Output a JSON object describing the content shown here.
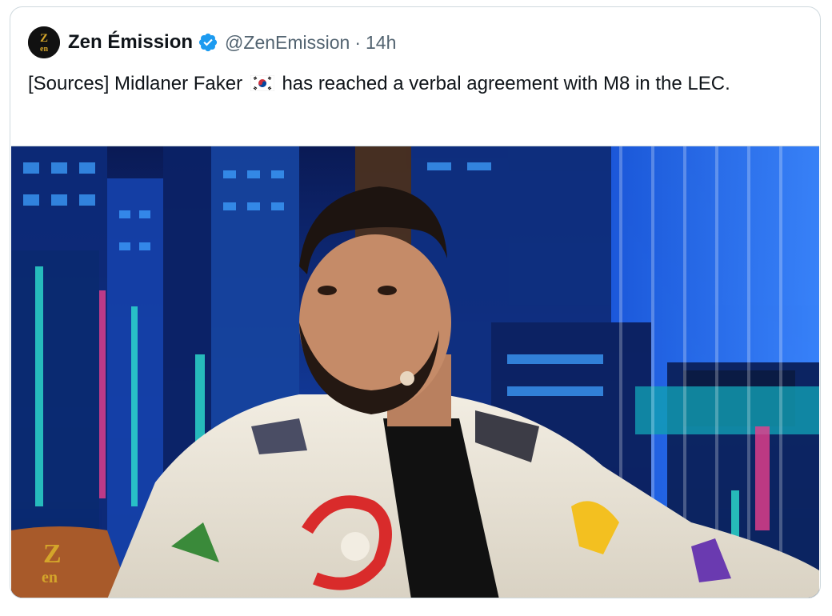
{
  "tweet": {
    "author_name": "Zen Émission",
    "author_handle": "@ZenEmission",
    "separator": "·",
    "time": "14h",
    "text_before_flag": "[Sources] Midlaner Faker",
    "text_after_flag": "has reached a verbal agreement with M8 in the LEC.",
    "flag_icon": "south-korea-flag-icon",
    "verified_color": "#1d9bf0"
  },
  "avatar": {
    "logo_text": "Zen",
    "color": "#d4a52a"
  },
  "media": {
    "watermark_text": "Zen",
    "description_icon": "city-background-photo"
  }
}
